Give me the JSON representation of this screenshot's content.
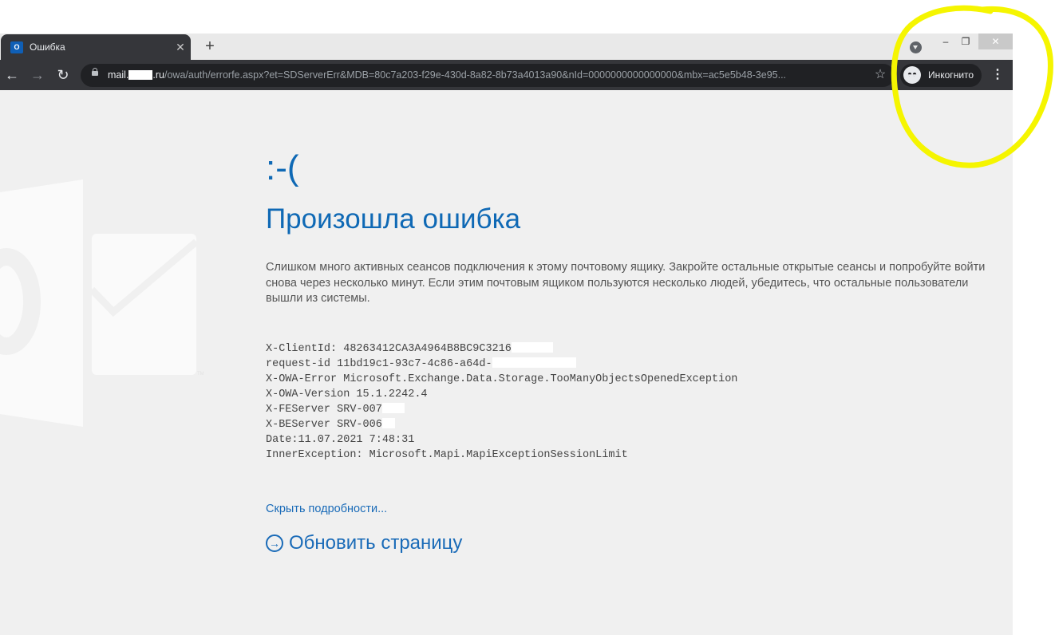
{
  "tab": {
    "title": "Ошибка",
    "favicon": "outlook-icon",
    "favicon_text": "O"
  },
  "toolbar": {
    "url_host": "mail.",
    "url_host_suffix": ".ru",
    "url_path": "/owa/auth/errorfe.aspx?et=SDServerErr&MDB=80c7a203-f29e-430d-8a82-8b73a4013a90&nId=0000000000000000&mbx=ac5e5b48-3e95...",
    "profile_label": "Инкогнито"
  },
  "error": {
    "face": ":-(",
    "title": "Произошла ошибка",
    "message": "Слишком много активных сеансов подключения к этому почтовому ящику. Закройте остальные открытые сеансы и попробуйте войти снова через несколько минут. Если этим почтовым ящиком пользуются несколько людей, убедитесь, что остальные пользователи вышли из системы."
  },
  "details": {
    "client_id": "X-ClientId: 48263412CA3A4964B8BC9C3216",
    "request_id": "request-id 11bd19c1-93c7-4c86-a64d-",
    "owa_error": "X-OWA-Error Microsoft.Exchange.Data.Storage.TooManyObjectsOpenedException",
    "owa_version": "X-OWA-Version 15.1.2242.4",
    "fe_server": "X-FEServer SRV-007",
    "be_server": "X-BEServer SRV-006",
    "date": "Date:11.07.2021 7:48:31",
    "inner_exception": "InnerException: Microsoft.Mapi.MapiExceptionSessionLimit"
  },
  "links": {
    "hide_details": "Скрыть подробности...",
    "refresh": "Обновить страницу"
  },
  "colors": {
    "accent": "#0f69b5",
    "annotation": "#f5f500",
    "chrome_dark": "#35363a"
  }
}
